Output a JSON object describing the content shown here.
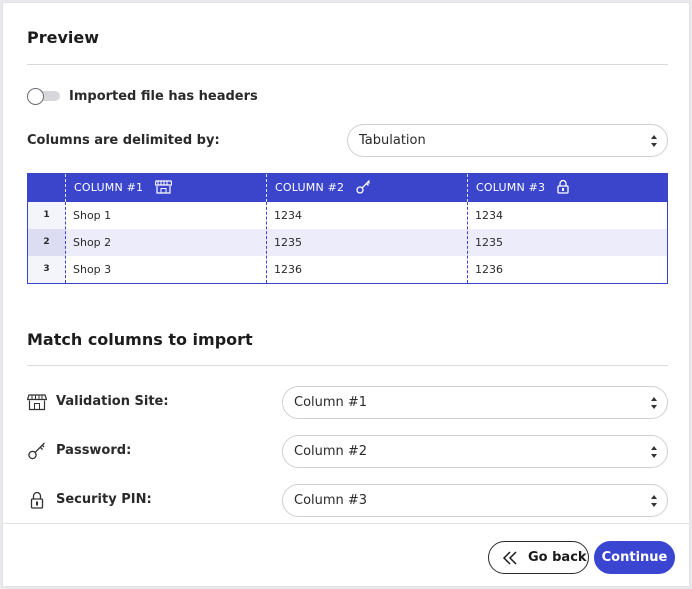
{
  "preview": {
    "title": "Preview",
    "toggle_label": "Imported file has headers",
    "toggle_on": false,
    "delimiter_label": "Columns are delimited by:",
    "delimiter_value": "Tabulation",
    "table": {
      "columns": [
        {
          "label": "COLUMN #1",
          "icon": "shop-icon"
        },
        {
          "label": "COLUMN #2",
          "icon": "key-icon"
        },
        {
          "label": "COLUMN #3",
          "icon": "lock-icon"
        }
      ],
      "rows": [
        {
          "index": "1",
          "cells": [
            "Shop 1",
            "1234",
            "1234"
          ]
        },
        {
          "index": "2",
          "cells": [
            "Shop 2",
            "1235",
            "1235"
          ]
        },
        {
          "index": "3",
          "cells": [
            "Shop 3",
            "1236",
            "1236"
          ]
        }
      ]
    }
  },
  "match": {
    "title": "Match columns to import",
    "fields": [
      {
        "label": "Validation Site:",
        "icon": "shop-icon",
        "value": "Column #1"
      },
      {
        "label": "Password:",
        "icon": "key-icon",
        "value": "Column #2"
      },
      {
        "label": "Security PIN:",
        "icon": "lock-icon",
        "value": "Column #3"
      }
    ]
  },
  "footer": {
    "back_label": "Go back",
    "continue_label": "Continue"
  },
  "colors": {
    "accent": "#3b45cc",
    "row_alt": "#ececfa"
  }
}
